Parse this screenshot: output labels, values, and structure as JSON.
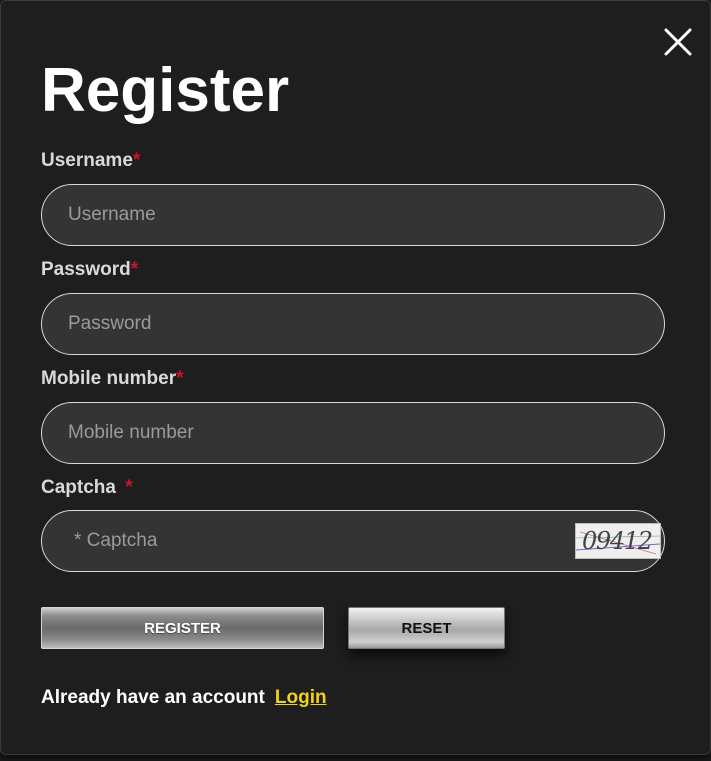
{
  "dialog": {
    "title": "Register",
    "close_icon": "close-icon"
  },
  "fields": {
    "username": {
      "label": "Username",
      "required_mark": "*",
      "placeholder": "Username",
      "value": ""
    },
    "password": {
      "label": "Password",
      "required_mark": "*",
      "placeholder": "Password",
      "value": ""
    },
    "mobile": {
      "label": "Mobile number",
      "required_mark": "*",
      "placeholder": "Mobile number",
      "value": ""
    },
    "captcha": {
      "label": "Captcha ",
      "required_mark": "*",
      "placeholder": "* Captcha",
      "value": "",
      "code": "09412"
    }
  },
  "buttons": {
    "register": "REGISTER",
    "reset": "RESET"
  },
  "footer": {
    "text": "Already have an account",
    "login_link": "Login"
  },
  "colors": {
    "background": "#1e1e1e",
    "input_bg": "#343434",
    "required": "#d0112b",
    "link": "#f0d11c"
  }
}
